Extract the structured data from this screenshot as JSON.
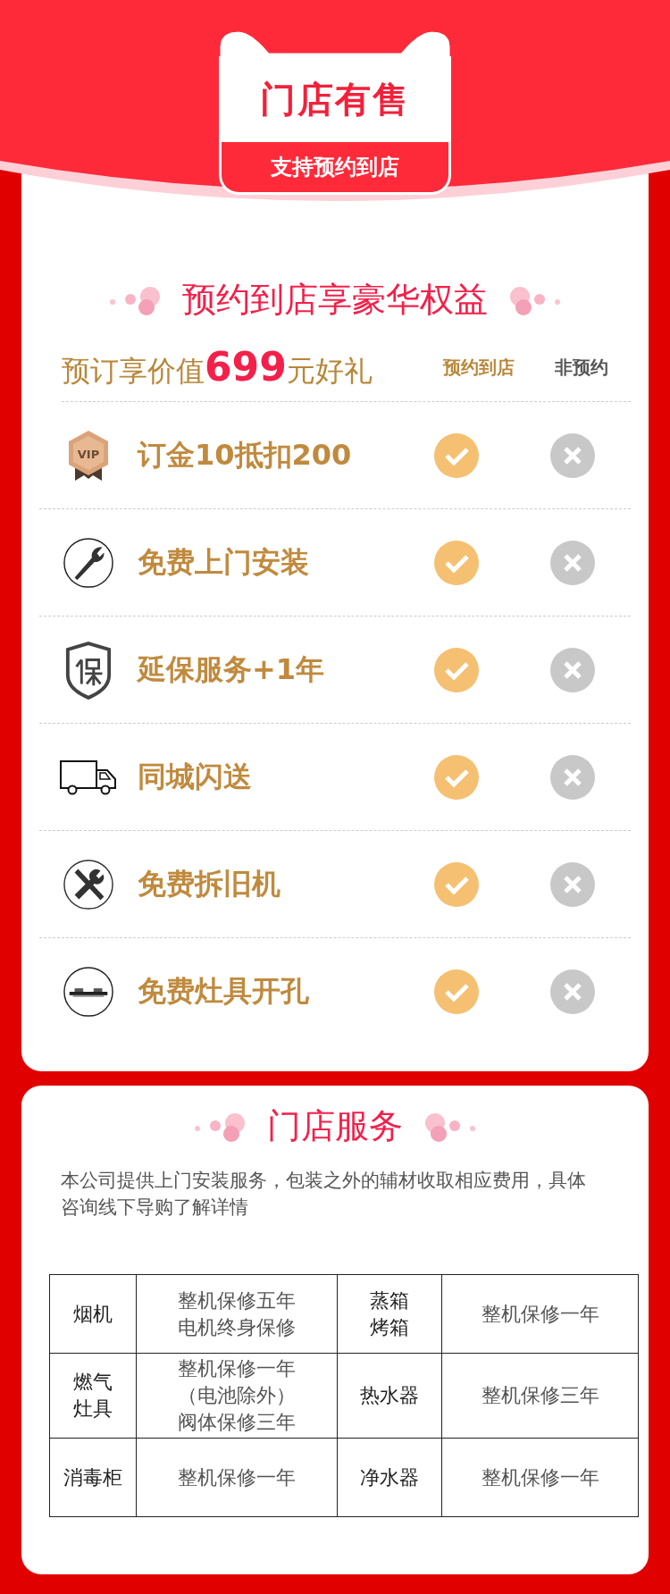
{
  "badge": {
    "title": "门店有售",
    "subtitle": "支持预约到店"
  },
  "benefits": {
    "heading": "预约到店享豪华权益",
    "offer": "预订享价值**699**元好礼",
    "column_1": "预约到店",
    "column_2": "非预约",
    "rows": [
      {
        "kind": "vip",
        "badge_text": "VIP",
        "label": "订金10抵扣200",
        "reserved": true,
        "walk_in": false
      },
      {
        "kind": "wrench",
        "label": "免费上门安装",
        "reserved": true,
        "walk_in": false
      },
      {
        "kind": "shield",
        "label": "延保服务+1年",
        "reserved": true,
        "walk_in": false
      },
      {
        "kind": "truck",
        "label": "同城闪送",
        "reserved": true,
        "walk_in": false
      },
      {
        "kind": "tools",
        "label": "免费拆旧机",
        "reserved": true,
        "walk_in": false
      },
      {
        "kind": "hob",
        "label": "免费灶具开孔",
        "reserved": true,
        "walk_in": false
      }
    ]
  },
  "service": {
    "heading": "门店服务",
    "note": "本公司提供上门安装服务，包装之外的辅材收取相应费用，具体咨询线下导购了解详情",
    "table": [
      [
        {
          "lines": [
            "烟机"
          ]
        },
        {
          "lines": [
            "整机保修五年",
            "电机终身保修"
          ]
        },
        {
          "lines": [
            "蒸箱",
            "烤箱"
          ]
        },
        {
          "lines": [
            "整机保修一年"
          ]
        }
      ],
      [
        {
          "lines": [
            "燃气",
            "灶具"
          ]
        },
        {
          "lines": [
            "整机保修一年",
            "（电池除外）",
            "阀体保修三年"
          ]
        },
        {
          "lines": [
            "热水器"
          ]
        },
        {
          "lines": [
            "整机保修三年"
          ]
        }
      ],
      [
        {
          "lines": [
            "消毒柜"
          ]
        },
        {
          "lines": [
            "整机保修一年"
          ]
        },
        {
          "lines": [
            "净水器"
          ]
        },
        {
          "lines": [
            "整机保修一年"
          ]
        }
      ]
    ]
  }
}
